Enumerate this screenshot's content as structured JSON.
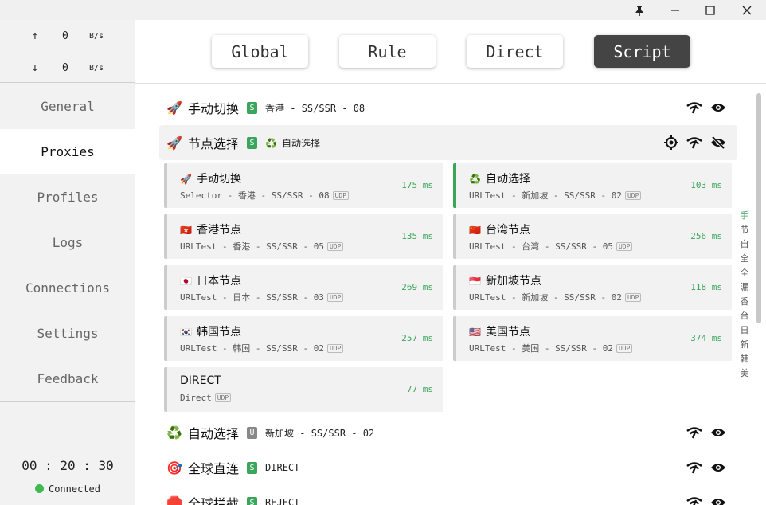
{
  "window": {
    "pin_icon": "pin-icon",
    "minimize_icon": "minimize-icon",
    "maximize_icon": "maximize-icon",
    "close_icon": "close-icon"
  },
  "traffic": {
    "up_arrow": "↑",
    "up_value": "0",
    "up_unit": "B/s",
    "down_arrow": "↓",
    "down_value": "0",
    "down_unit": "B/s"
  },
  "nav": [
    "General",
    "Proxies",
    "Profiles",
    "Logs",
    "Connections",
    "Settings",
    "Feedback"
  ],
  "nav_active": "Proxies",
  "uptime": "00 : 20 : 30",
  "status": "Connected",
  "modes": [
    "Global",
    "Rule",
    "Direct",
    "Script"
  ],
  "mode_active": "Script",
  "groups": [
    {
      "icon": "🚀",
      "name": "手动切换",
      "badge": "S",
      "selected_icon": "",
      "selected": "香港 - SS/SSR - 08"
    },
    {
      "icon": "🚀",
      "name": "节点选择",
      "badge": "S",
      "selected_icon": "♻️",
      "selected": "自动选择"
    },
    {
      "icon": "♻️",
      "name": "自动选择",
      "badge": "U",
      "selected_icon": "",
      "selected": "新加坡 - SS/SSR - 02"
    },
    {
      "icon": "🎯",
      "name": "全球直连",
      "badge": "S",
      "selected_icon": "",
      "selected": "DIRECT"
    },
    {
      "icon": "🛑",
      "name": "全球拦截",
      "badge": "S",
      "selected_icon": "",
      "selected": "REJECT"
    }
  ],
  "proxies": [
    {
      "flag": "🚀",
      "name": "手动切换",
      "sub": "Selector - 香港 - SS/SSR - 08",
      "udp": "UDP",
      "delay": "175 ms"
    },
    {
      "flag": "♻️",
      "name": "自动选择",
      "sub": "URLTest - 新加坡 - SS/SSR - 02",
      "udp": "UDP",
      "delay": "103 ms"
    },
    {
      "flag": "🇭🇰",
      "name": "香港节点",
      "sub": "URLTest - 香港 - SS/SSR - 05",
      "udp": "UDP",
      "delay": "135 ms"
    },
    {
      "flag": "🇨🇳",
      "name": "台湾节点",
      "sub": "URLTest - 台湾 - SS/SSR - 05",
      "udp": "UDP",
      "delay": "256 ms"
    },
    {
      "flag": "🇯🇵",
      "name": "日本节点",
      "sub": "URLTest - 日本 - SS/SSR - 03",
      "udp": "UDP",
      "delay": "269 ms"
    },
    {
      "flag": "🇸🇬",
      "name": "新加坡节点",
      "sub": "URLTest - 新加坡 - SS/SSR - 02",
      "udp": "UDP",
      "delay": "118 ms"
    },
    {
      "flag": "🇰🇷",
      "name": "韩国节点",
      "sub": "URLTest - 韩国 - SS/SSR - 02",
      "udp": "UDP",
      "delay": "257 ms"
    },
    {
      "flag": "🇺🇸",
      "name": "美国节点",
      "sub": "URLTest - 美国 - SS/SSR - 02",
      "udp": "UDP",
      "delay": "374 ms"
    },
    {
      "flag": "",
      "name": "DIRECT",
      "sub": "Direct",
      "udp": "UDP",
      "delay": "77 ms"
    }
  ],
  "selected_proxy": "自动选择",
  "colors": {
    "accent": "#3ba55c",
    "active_mode": "#444444"
  },
  "index_letters": [
    "手",
    "节",
    "自",
    "全",
    "全",
    "漏",
    "香",
    "台",
    "日",
    "新",
    "韩",
    "美"
  ]
}
